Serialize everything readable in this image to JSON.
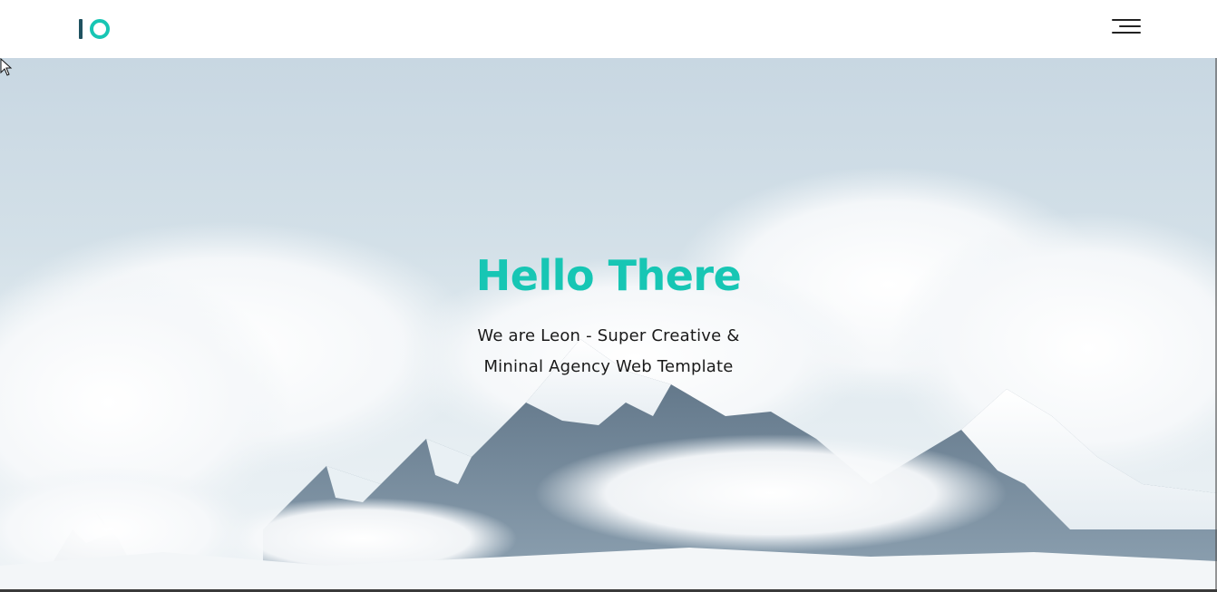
{
  "header": {
    "logo_alt": "IO",
    "menu_icon": "hamburger-menu-icon"
  },
  "hero": {
    "title": "Hello There",
    "subtitle_line1": "We are Leon - Super Creative &",
    "subtitle_line2": "Mininal Agency Web Template",
    "background": "snowy-mountains-clouds-photo"
  },
  "colors": {
    "accent": "#17c6b4",
    "logo_dark": "#1f5260",
    "text": "#1a1a1a",
    "header_bg": "#ffffff"
  }
}
